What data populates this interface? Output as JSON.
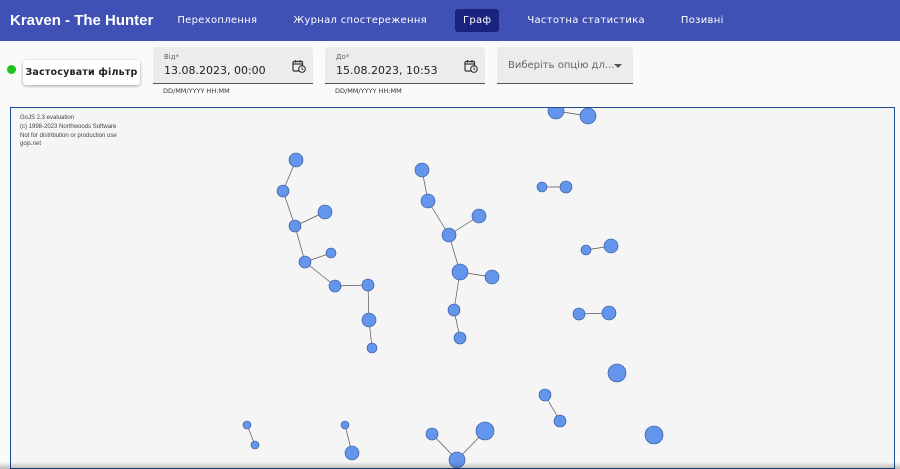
{
  "app": {
    "title": "Kraven - The Hunter"
  },
  "nav": {
    "items": [
      {
        "label": "Перехоплення",
        "active": false
      },
      {
        "label": "Журнал спостереження",
        "active": false
      },
      {
        "label": "Граф",
        "active": true
      },
      {
        "label": "Частотна статистика",
        "active": false
      },
      {
        "label": "Позивні",
        "active": false
      }
    ]
  },
  "filter": {
    "status_color": "#1ec31e",
    "apply_label": "Застосувати фільтр",
    "from": {
      "label": "Від*",
      "value": "13.08.2023, 00:00",
      "hint": "DD/MM/YYYY HH:MM",
      "icon": "calendar-clock-icon"
    },
    "to": {
      "label": "До*",
      "value": "15.08.2023, 10:53",
      "hint": "DD/MM/YYYY HH:MM",
      "icon": "calendar-clock-icon"
    },
    "select": {
      "value": "Виберіть опцію дл...",
      "icon": "chevron-down-icon"
    }
  },
  "graph": {
    "watermark": [
      "GoJS 2.3 evaluation",
      "(c) 1998-2023 Northwoods Software",
      "Not for distribution or production use",
      "gojs.net"
    ],
    "node_color": "#6495ed"
  },
  "colors": {
    "appbar": "#3f51b5",
    "active_nav": "#1a237e",
    "node": "#6495ed"
  }
}
